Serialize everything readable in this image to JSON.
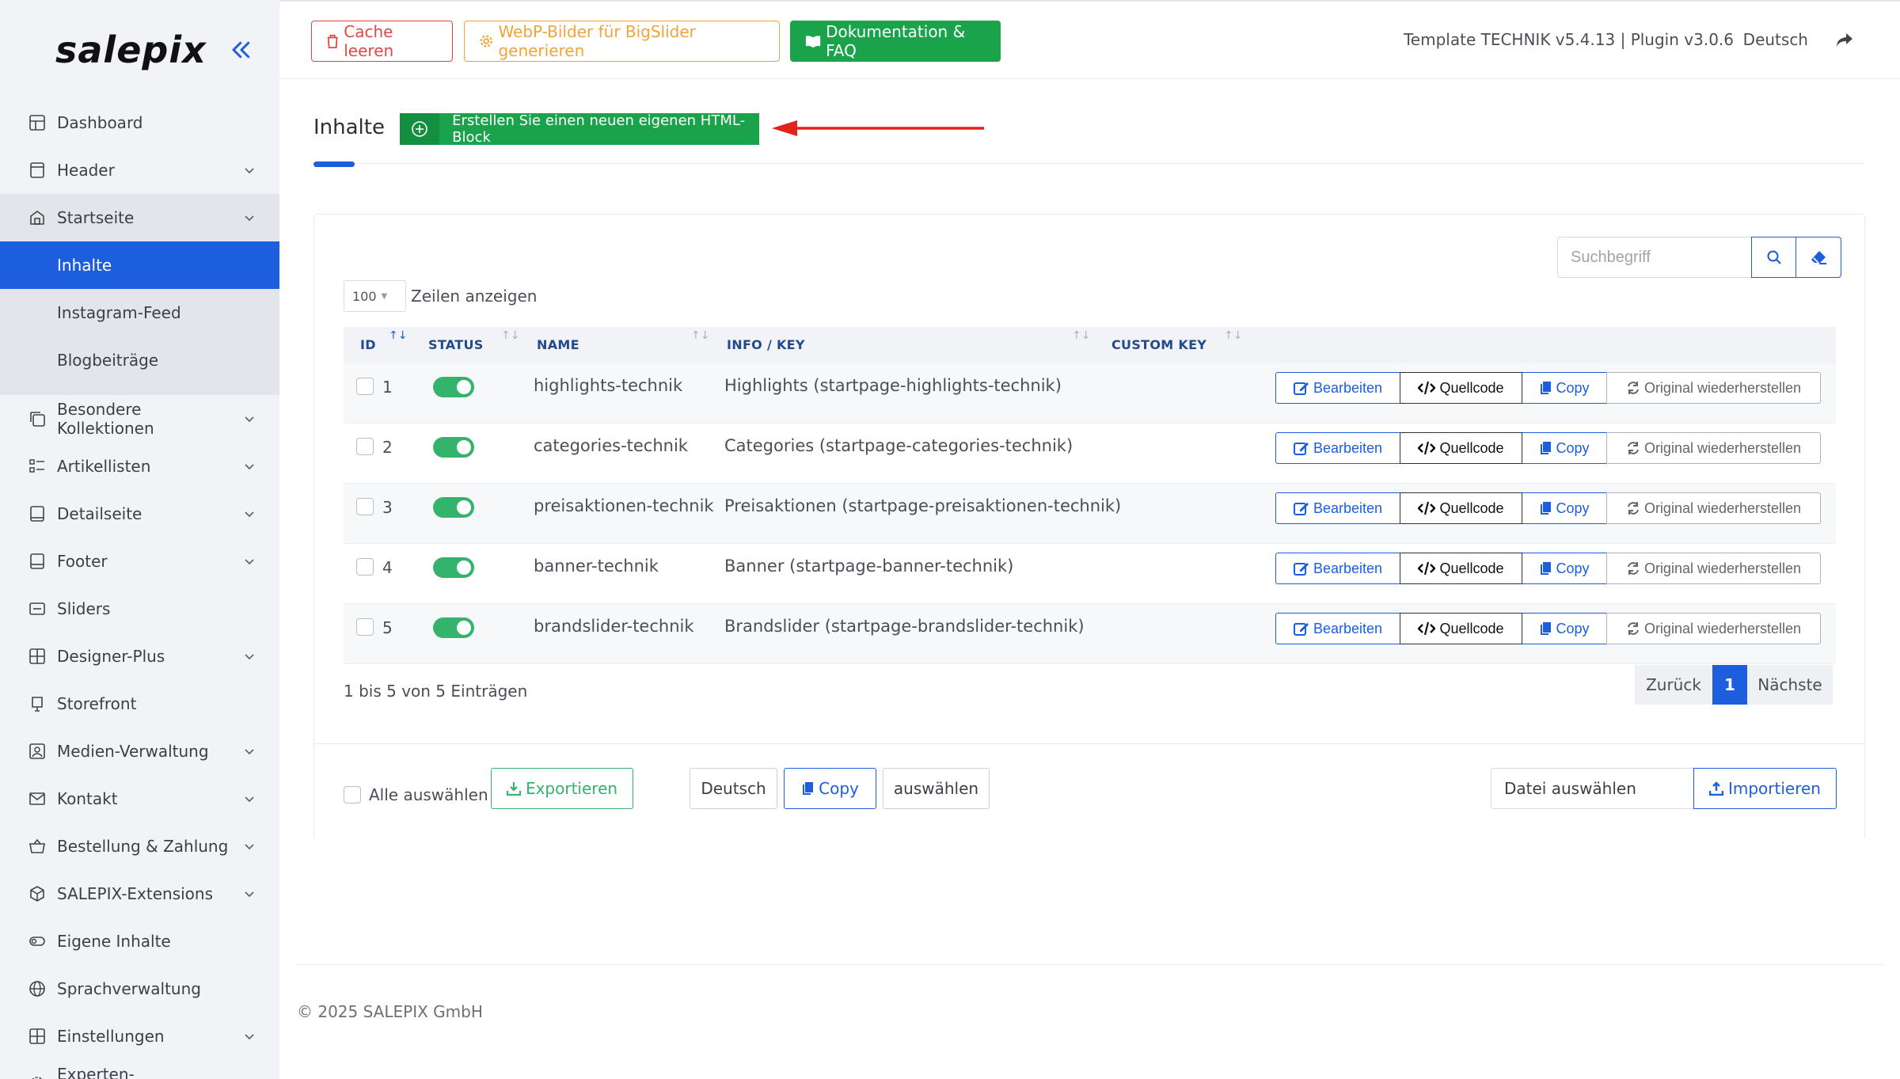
{
  "sidebar": {
    "logo": "salepix",
    "items": [
      {
        "label": "Dashboard",
        "icon": "dashboard-icon",
        "chevron": false
      },
      {
        "label": "Header",
        "icon": "header-icon",
        "chevron": true
      },
      {
        "label": "Startseite",
        "icon": "home-icon",
        "chevron": true,
        "open": true,
        "children": [
          {
            "label": "Inhalte",
            "active": true
          },
          {
            "label": "Instagram-Feed"
          },
          {
            "label": "Blogbeiträge"
          }
        ]
      },
      {
        "label": "Besondere Kollektionen",
        "icon": "collections-icon",
        "chevron": true
      },
      {
        "label": "Artikellisten",
        "icon": "list-icon",
        "chevron": true
      },
      {
        "label": "Detailseite",
        "icon": "detail-icon",
        "chevron": true
      },
      {
        "label": "Footer",
        "icon": "footer-icon",
        "chevron": true
      },
      {
        "label": "Sliders",
        "icon": "slider-icon",
        "chevron": false
      },
      {
        "label": "Designer-Plus",
        "icon": "grid-icon",
        "chevron": true
      },
      {
        "label": "Storefront",
        "icon": "storefront-icon",
        "chevron": false
      },
      {
        "label": "Medien-Verwaltung",
        "icon": "media-icon",
        "chevron": true
      },
      {
        "label": "Kontakt",
        "icon": "mail-icon",
        "chevron": true
      },
      {
        "label": "Bestellung & Zahlung",
        "icon": "basket-icon",
        "chevron": true
      },
      {
        "label": "SALEPIX-Extensions",
        "icon": "cube-icon",
        "chevron": true
      },
      {
        "label": "Eigene Inhalte",
        "icon": "toggle-icon",
        "chevron": false
      },
      {
        "label": "Sprachverwaltung",
        "icon": "globe-icon",
        "chevron": false
      },
      {
        "label": "Einstellungen",
        "icon": "settings-grid-icon",
        "chevron": true
      },
      {
        "label": "Experten-Einstellungen",
        "icon": "gear-icon",
        "chevron": true
      }
    ]
  },
  "topbar": {
    "cache_label": "Cache leeren",
    "webp_label": "WebP-Bilder für BigSlider generieren",
    "doc_label": "Dokumentation & FAQ",
    "version": "Template TECHNIK v5.4.13 | Plugin v3.0.6",
    "language": "Deutsch"
  },
  "main": {
    "title": "Inhalte",
    "new_block_label": "Erstellen Sie einen neuen eigenen HTML-Block",
    "search_placeholder": "Suchbegriff",
    "page_length": "100",
    "page_length_label": "Zeilen anzeigen",
    "columns": [
      "ID",
      "STATUS",
      "NAME",
      "INFO / KEY",
      "CUSTOM KEY"
    ],
    "rows": [
      {
        "id": "1",
        "name": "highlights-technik",
        "info": "Highlights (startpage-highlights-technik)"
      },
      {
        "id": "2",
        "name": "categories-technik",
        "info": "Categories (startpage-categories-technik)"
      },
      {
        "id": "3",
        "name": "preisaktionen-technik",
        "info": "Preisaktionen (startpage-preisaktionen-technik)"
      },
      {
        "id": "4",
        "name": "banner-technik",
        "info": "Banner (startpage-banner-technik)"
      },
      {
        "id": "5",
        "name": "brandslider-technik",
        "info": "Brandslider (startpage-brandslider-technik)"
      }
    ],
    "row_actions": {
      "edit": "Bearbeiten",
      "source": "Quellcode",
      "copy": "Copy",
      "restore": "Original wiederherstellen"
    },
    "info_text": "1 bis 5 von 5 Einträgen",
    "pager": {
      "prev": "Zurück",
      "current": "1",
      "next": "Nächste"
    },
    "footer": {
      "select_all": "Alle auswählen",
      "export": "Exportieren",
      "language": "Deutsch",
      "copy": "Copy",
      "choose": "auswählen",
      "file_choose": "Datei auswählen",
      "import": "Importieren"
    }
  },
  "copyright": "© 2025 SALEPIX GmbH",
  "colors": {
    "primary": "#1c5ede",
    "success": "#1aa34a",
    "danger": "#e04848",
    "warning": "#f0a43a",
    "sidebar_bg": "#f2f3f6"
  }
}
